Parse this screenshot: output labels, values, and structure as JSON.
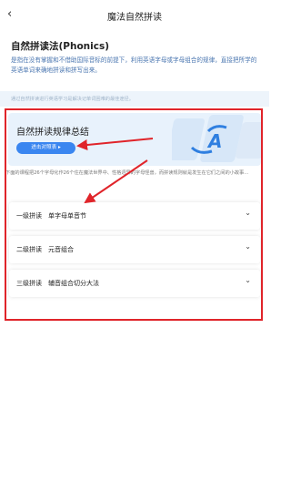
{
  "nav": {
    "back_icon": "‹",
    "title": "魔法自然拼读"
  },
  "intro": {
    "heading": "自然拼读法(Phonics)",
    "body": "是指在没有掌握和不借助国际音标的前提下，利用英语字母或字母组合的规律，直接把所学的英语单词来确地拼读和拼写出来。"
  },
  "tip": "通过自然拼读进行英语学习是解决记单词困难的最佳途径。",
  "card": {
    "title": "自然拼读规律总结",
    "button_label": "进击对照表 ▸",
    "deco_letter": "A"
  },
  "desc": "下面的课程把26个字母化作26个住在魔法世界中、性格迥异的字母怪兽，而拼读规则就是发生在它们之间的小故事…",
  "items": [
    {
      "level": "一级拼读",
      "name": "单字母单音节"
    },
    {
      "level": "二级拼读",
      "name": "元音组合"
    },
    {
      "level": "三级拼读",
      "name": "辅音组合切分大法"
    }
  ],
  "chevron": "⌄",
  "colors": {
    "accent": "#3a86f0",
    "annotation_red": "#e0242a",
    "card_bg": "#e8f2fc"
  }
}
